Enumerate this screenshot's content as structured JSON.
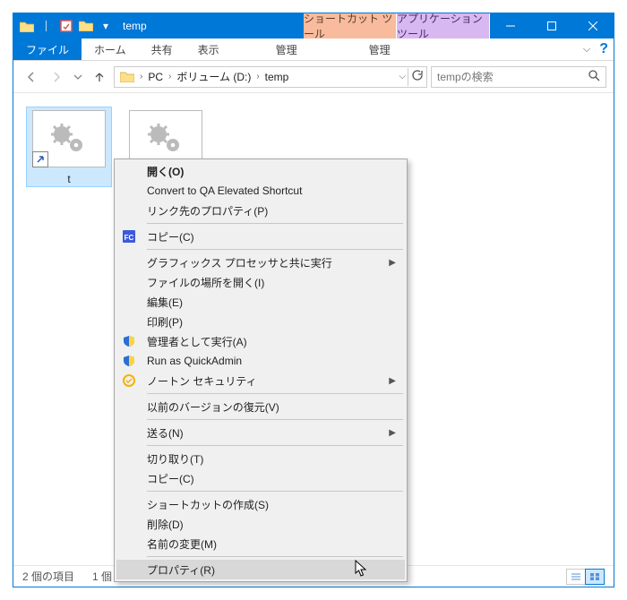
{
  "window": {
    "title": "temp",
    "tool_tab_shortcut": "ショートカット ツール",
    "tool_tab_app": "アプリケーション ツール"
  },
  "tabs": {
    "file": "ファイル",
    "home": "ホーム",
    "share": "共有",
    "view": "表示",
    "manage1": "管理",
    "manage2": "管理"
  },
  "breadcrumb": {
    "pc": "PC",
    "drive": "ボリューム (D:)",
    "folder": "temp"
  },
  "search": {
    "placeholder": "tempの検索"
  },
  "files": {
    "item1": {
      "name": "t"
    },
    "item2": {
      "name": ""
    }
  },
  "status": {
    "count": "2 個の項目",
    "selected": "1 個"
  },
  "context_menu": {
    "open": "開く(O)",
    "convert_qa": "Convert to QA Elevated Shortcut",
    "link_props": "リンク先のプロパティ(P)",
    "copy": "コピー(C)",
    "gpu": "グラフィックス プロセッサと共に実行",
    "open_loc": "ファイルの場所を開く(I)",
    "edit": "編集(E)",
    "print": "印刷(P)",
    "run_admin": "管理者として実行(A)",
    "quickadmin": "Run as QuickAdmin",
    "norton": "ノートン セキュリティ",
    "restore_ver": "以前のバージョンの復元(V)",
    "send_to": "送る(N)",
    "cut": "切り取り(T)",
    "copy2": "コピー(C)",
    "create_shortcut": "ショートカットの作成(S)",
    "delete": "削除(D)",
    "rename": "名前の変更(M)",
    "properties": "プロパティ(R)"
  }
}
